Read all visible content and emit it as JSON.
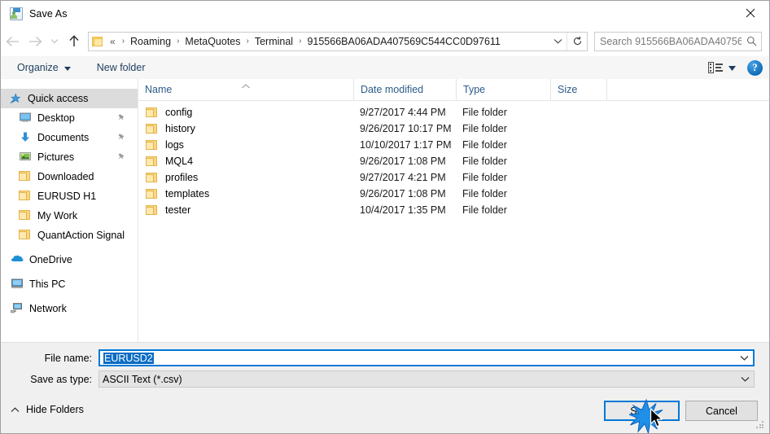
{
  "window": {
    "title": "Save As",
    "icon": "save-as-icon",
    "close_label": "✕"
  },
  "nav": {
    "back": "back-arrow",
    "forward": "forward-arrow",
    "recent": "recent-locations-chevron",
    "up": "up-arrow",
    "refresh": "refresh-icon",
    "address_dropdown": "chevron-down-icon",
    "breadcrumb_prefix": "«",
    "breadcrumbs": [
      "Roaming",
      "MetaQuotes",
      "Terminal",
      "915566BA06ADA407569C544CC0D97611"
    ],
    "separator": "›"
  },
  "search": {
    "placeholder": "Search 915566BA06ADA40756...",
    "icon": "search-icon"
  },
  "toolbar": {
    "organize_label": "Organize",
    "new_folder_label": "New folder",
    "view_icon": "view-options-icon",
    "help_label": "?"
  },
  "sidebar": {
    "items": [
      {
        "label": "Quick access",
        "icon": "star-icon",
        "selected": true,
        "pinned": false,
        "indent": "group"
      },
      {
        "label": "Desktop",
        "icon": "monitor-icon",
        "selected": false,
        "pinned": true,
        "indent": "child"
      },
      {
        "label": "Documents",
        "icon": "download-arrow-icon",
        "selected": false,
        "pinned": true,
        "indent": "child"
      },
      {
        "label": "Pictures",
        "icon": "picture-icon",
        "selected": false,
        "pinned": true,
        "indent": "child"
      },
      {
        "label": "Downloaded",
        "icon": "folder-icon",
        "selected": false,
        "pinned": false,
        "indent": "child"
      },
      {
        "label": "EURUSD H1",
        "icon": "folder-icon",
        "selected": false,
        "pinned": false,
        "indent": "child"
      },
      {
        "label": "My Work",
        "icon": "folder-icon",
        "selected": false,
        "pinned": false,
        "indent": "child"
      },
      {
        "label": "QuantAction Signal",
        "icon": "folder-icon",
        "selected": false,
        "pinned": false,
        "indent": "child"
      },
      {
        "label": "OneDrive",
        "icon": "onedrive-cloud-icon",
        "selected": false,
        "pinned": false,
        "indent": "group"
      },
      {
        "label": "This PC",
        "icon": "this-pc-icon",
        "selected": false,
        "pinned": false,
        "indent": "group"
      },
      {
        "label": "Network",
        "icon": "network-icon",
        "selected": false,
        "pinned": false,
        "indent": "group"
      }
    ]
  },
  "filelist": {
    "columns": [
      "Name",
      "Date modified",
      "Type",
      "Size"
    ],
    "sorted_by": "Name",
    "sort_direction": "ascending",
    "rows": [
      {
        "name": "config",
        "date": "9/27/2017 4:44 PM",
        "type": "File folder",
        "size": ""
      },
      {
        "name": "history",
        "date": "9/26/2017 10:17 PM",
        "type": "File folder",
        "size": ""
      },
      {
        "name": "logs",
        "date": "10/10/2017 1:17 PM",
        "type": "File folder",
        "size": ""
      },
      {
        "name": "MQL4",
        "date": "9/26/2017 1:08 PM",
        "type": "File folder",
        "size": ""
      },
      {
        "name": "profiles",
        "date": "9/27/2017 4:21 PM",
        "type": "File folder",
        "size": ""
      },
      {
        "name": "templates",
        "date": "9/26/2017 1:08 PM",
        "type": "File folder",
        "size": ""
      },
      {
        "name": "tester",
        "date": "10/4/2017 1:35 PM",
        "type": "File folder",
        "size": ""
      }
    ]
  },
  "form": {
    "filename_label": "File name:",
    "filename_value": "EURUSD2",
    "filetype_label": "Save as type:",
    "filetype_value": "ASCII Text (*.csv)"
  },
  "footer": {
    "hide_folders_label": "Hide Folders",
    "save_label": "Save",
    "cancel_label": "Cancel"
  },
  "colors": {
    "accent": "#0078d7",
    "folder": "#fcd77f",
    "selection": "#0a6cc4",
    "link_text": "#2b5c8a",
    "chrome_bg": "#f0f0f0"
  }
}
